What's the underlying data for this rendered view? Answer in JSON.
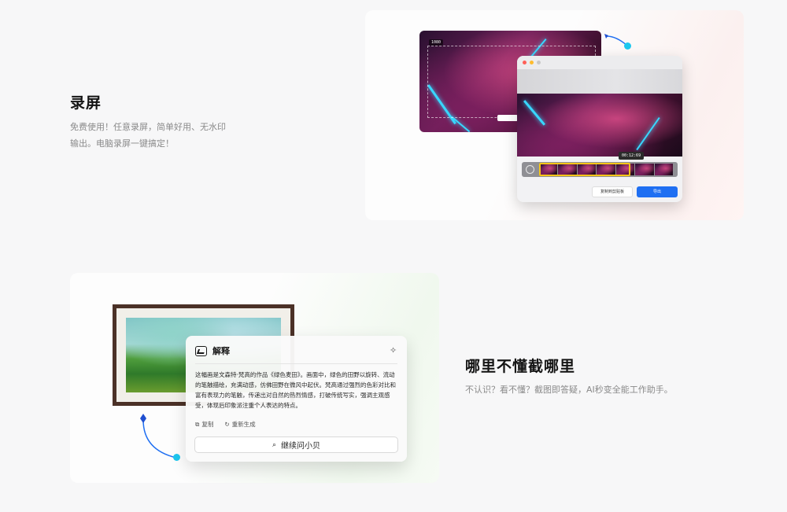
{
  "section_record": {
    "title": "录屏",
    "desc_line1": "免费使用！任意录屏，简单好用、无水印",
    "desc_line2": "输出。电脑录屏一键搞定！",
    "selection_tag": "1080",
    "timestamp": "00:12:69",
    "copy_button": "复制到剪贴板",
    "export_button": "导出"
  },
  "section_ai": {
    "title": "哪里不懂截哪里",
    "desc": "不认识？看不懂？截图即答疑，AI秒变全能工作助手。",
    "popup": {
      "title": "解释",
      "body": "这幅画是文森特·梵高的作品《绿色麦田》。画面中，绿色的田野以旋转、流动的笔触描绘，充满动感，仿佛田野在微风中起伏。梵高通过强烈的色彩对比和富有表现力的笔触，传递出对自然的热烈情感，打破传统写实，强调主观感受，体现后印象派注重个人表达的特点。",
      "copy": "复制",
      "regenerate": "重新生成",
      "ask": "继续问小贝"
    }
  },
  "colors": {
    "accent_blue": "#1f6ff2",
    "cyan": "#1cc7ef",
    "timeline_yellow": "#f5c518"
  }
}
